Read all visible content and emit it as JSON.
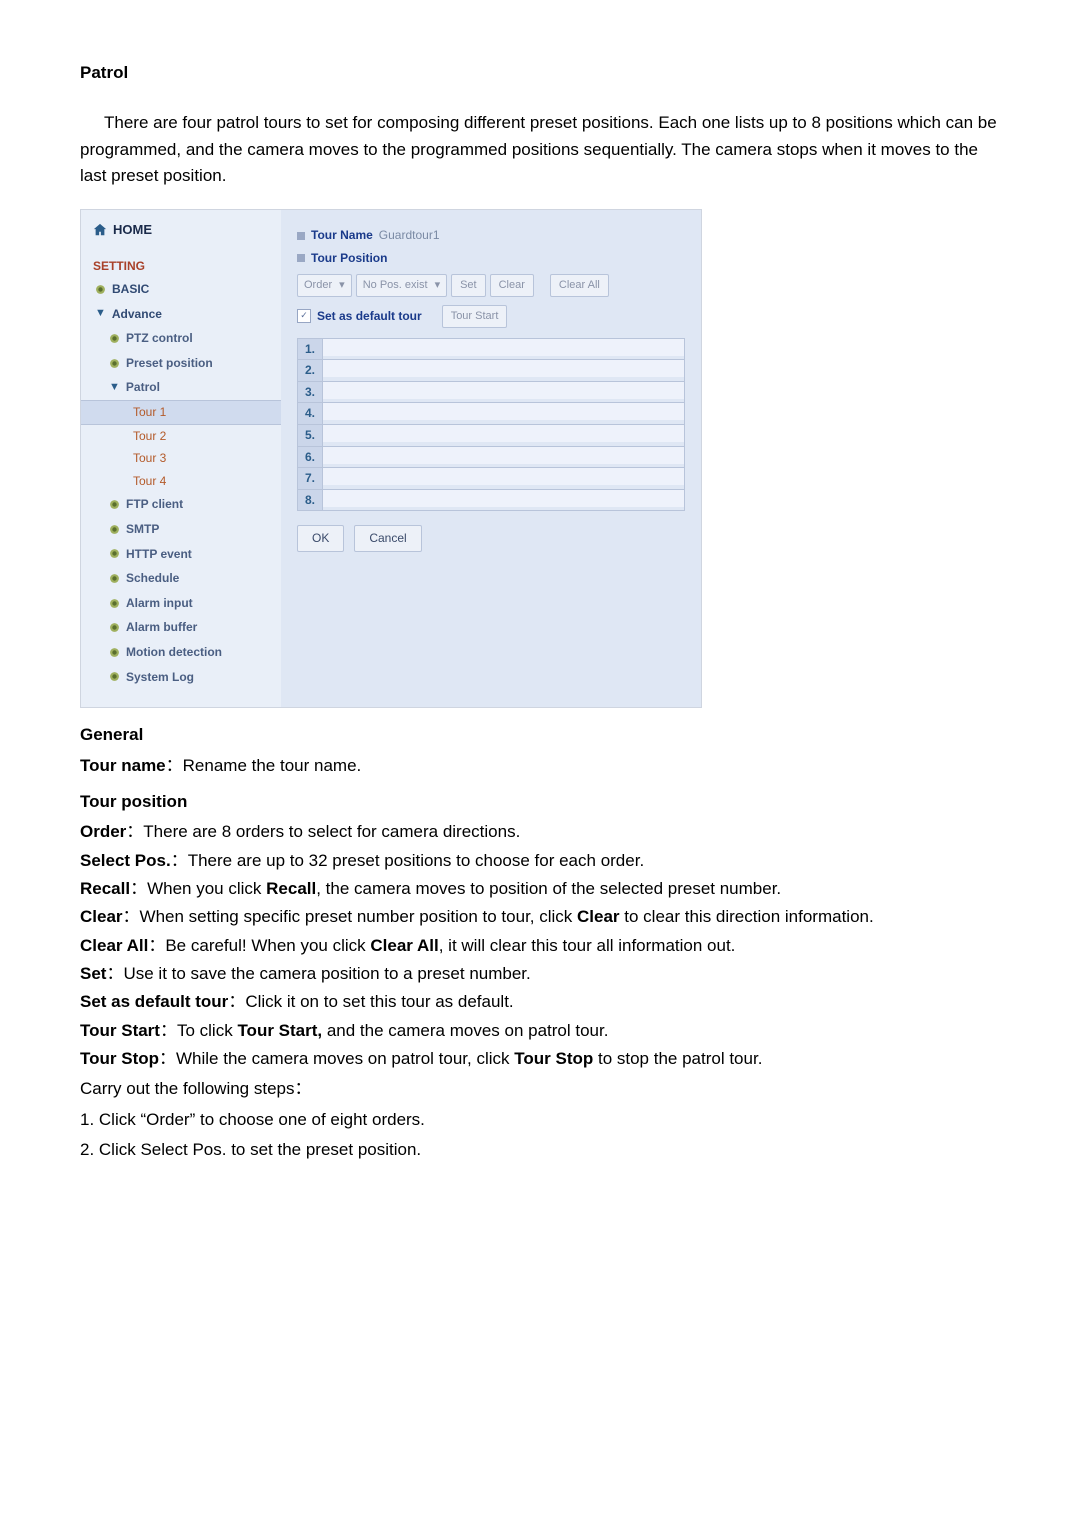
{
  "title": "Patrol",
  "intro": "There are four patrol tours to set for composing different preset positions. Each one lists up to 8 positions which can be programmed, and the camera moves to the programmed positions sequentially. The camera stops when it moves to the last preset position.",
  "ui": {
    "home": "HOME",
    "setting": "SETTING",
    "basic": "BASIC",
    "advance": "Advance",
    "ptz": "PTZ control",
    "preset": "Preset position",
    "patrol": "Patrol",
    "tours": [
      "Tour 1",
      "Tour 2",
      "Tour 3",
      "Tour 4"
    ],
    "ftp": "FTP client",
    "smtp": "SMTP",
    "http": "HTTP event",
    "schedule": "Schedule",
    "alarmIn": "Alarm input",
    "alarmBuf": "Alarm buffer",
    "motion": "Motion detection",
    "syslog": "System Log",
    "tourNameLabel": "Tour Name",
    "tourNameValue": "Guardtour1",
    "tourPositionLabel": "Tour Position",
    "orderLabel": "Order",
    "noPosLabel": "No Pos. exist",
    "setBtn": "Set",
    "clearBtn": "Clear",
    "clearAllBtn": "Clear All",
    "defaultTourLabel": "Set as default tour",
    "tourStartBtn": "Tour Start",
    "positions": [
      "1.",
      "2.",
      "3.",
      "4.",
      "5.",
      "6.",
      "7.",
      "8."
    ],
    "okBtn": "OK",
    "cancelBtn": "Cancel"
  },
  "general": {
    "heading": "General",
    "tourName": {
      "label": "Tour name",
      "text": "Rename the tour name."
    },
    "tourPositionHeading": "Tour position",
    "order": {
      "label": "Order",
      "text": "There are 8 orders to select for camera directions."
    },
    "selectPos": {
      "label": "Select Pos.",
      "text": "There are up to 32 preset positions to choose for each order."
    },
    "recall": {
      "label": "Recall",
      "pre": "When you click ",
      "bold": "Recall",
      "post": ", the camera moves to position of the selected preset number."
    },
    "clear": {
      "label": "Clear",
      "pre": "When setting specific preset number position to tour, click ",
      "bold": "Clear",
      "post": " to clear this direction information."
    },
    "clearAll": {
      "label": "Clear All",
      "pre": "Be careful! When you click ",
      "bold": "Clear All",
      "post": ", it will clear this tour all information out."
    },
    "set": {
      "label": "Set",
      "text": "Use it to save the camera position to a preset number."
    },
    "setDefault": {
      "label": "Set as default tour",
      "text": "Click it on to set this tour as default."
    },
    "tourStart": {
      "label": "Tour Start",
      "pre": "To click ",
      "bold": "Tour Start,",
      "post": " and the camera moves on patrol tour."
    },
    "tourStop": {
      "label": "Tour Stop",
      "pre": "While the camera moves on patrol tour, click ",
      "bold": "Tour Stop",
      "post": " to stop the patrol tour."
    },
    "carryOut": "Carry out the following steps：",
    "step1pre": "1.  Click “",
    "step1bold": "Order",
    "step1post": "” to choose one of eight orders.",
    "step2pre": "2.  Click ",
    "step2bold": "Select Pos.",
    "step2post": " to set the preset position."
  }
}
